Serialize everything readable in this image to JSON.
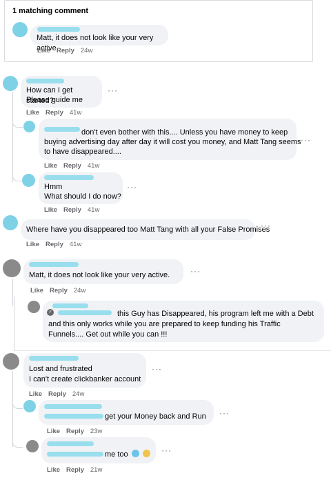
{
  "header": {
    "title": "1 matching comment"
  },
  "actions": {
    "like": "Like",
    "reply": "Reply"
  },
  "comments": [
    {
      "text": "Matt, it does not look like your very active.",
      "time": "24w"
    },
    {
      "text_line1": "How can I get started?",
      "text_line2": "Please guide me",
      "time": "41w"
    },
    {
      "text_line1": "don't even bother with this.... Unless you have money to keep",
      "text_line2": "buying advertising day after day it will cost you money, and Matt Tang seems",
      "text_line3": "to have disappeared....",
      "time": "41w"
    },
    {
      "text_line1": "Hmm",
      "text_line2": "What should I do now?",
      "time": "41w"
    },
    {
      "text": "Where have you disappeared too Matt Tang with all your False Promises",
      "time": "41w"
    },
    {
      "text": "Matt, it does not look like your very active.",
      "time": "24w"
    },
    {
      "text_line1": "this Guy has Disappeared, his program left me with a Debt",
      "text_line2": "and this only works while you are prepared to keep funding his Traffic",
      "text_line3": "Funnels.... Get out while you can !!!"
    },
    {
      "text_line1": "Lost and frustrated",
      "text_line2": "I can't create clickbanker account",
      "time": "24w"
    },
    {
      "text": "get your Money back and Run",
      "time": "23w"
    },
    {
      "text": "me too",
      "time": "21w"
    }
  ],
  "icons": {
    "more": "more-options-icon",
    "author_badge": "author-badge-icon",
    "emoji1": "frowning-face-icon",
    "emoji2": "worried-face-icon"
  },
  "colors": {
    "bubble": "#f0f2f5",
    "meta": "#65676b",
    "redacted": "#8fdcec"
  },
  "more_glyph": "···"
}
